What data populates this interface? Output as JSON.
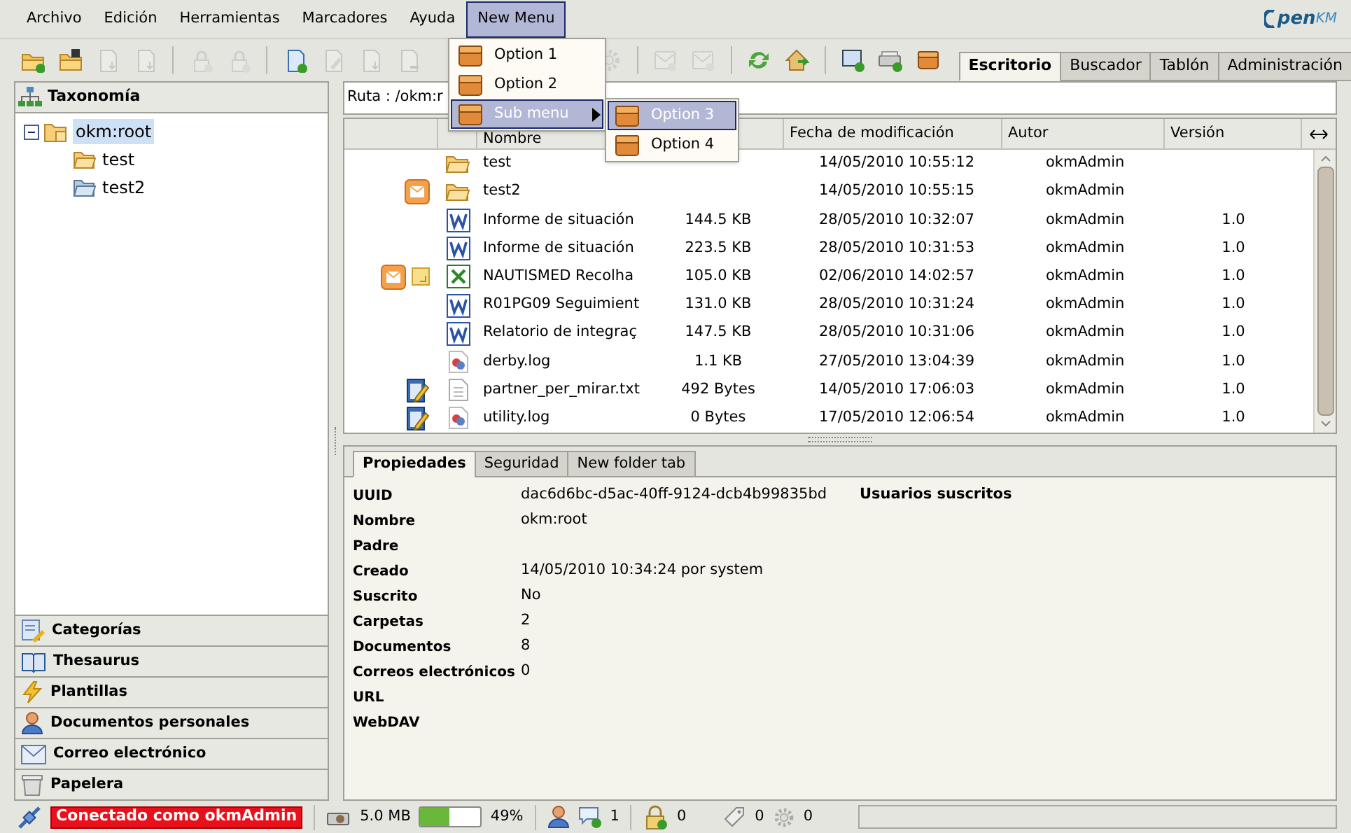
{
  "menubar": [
    {
      "label": "Archivo",
      "selected": false
    },
    {
      "label": "Edición",
      "selected": false
    },
    {
      "label": "Herramientas",
      "selected": false
    },
    {
      "label": "Marcadores",
      "selected": false
    },
    {
      "label": "Ayuda",
      "selected": false
    },
    {
      "label": "New Menu",
      "selected": true
    }
  ],
  "menu": [
    {
      "label": "Option 1",
      "selected": false
    },
    {
      "label": "Option 2",
      "selected": false
    },
    {
      "label": "Sub menu",
      "selected": true,
      "submenu": [
        {
          "label": "Option 3",
          "selected": true
        },
        {
          "label": "Option 4",
          "selected": false
        }
      ]
    }
  ],
  "logo": {
    "text": "pen",
    "suffix": "KM"
  },
  "toolbar_left": [
    {
      "kind": "folder-add",
      "disabled": false
    },
    {
      "kind": "folder-find",
      "disabled": false
    },
    {
      "kind": "download",
      "disabled": true
    },
    {
      "kind": "download-pdf",
      "disabled": true
    },
    {
      "kind": "separator"
    },
    {
      "kind": "lock",
      "disabled": true
    },
    {
      "kind": "unlock",
      "disabled": true
    },
    {
      "kind": "separator"
    },
    {
      "kind": "document-add",
      "disabled": false
    },
    {
      "kind": "edit",
      "disabled": true
    },
    {
      "kind": "checkin",
      "disabled": true
    },
    {
      "kind": "cancel",
      "disabled": true
    }
  ],
  "toolbar_right": [
    {
      "kind": "gear",
      "disabled": true
    },
    {
      "kind": "separator"
    },
    {
      "kind": "mail-add",
      "disabled": true
    },
    {
      "kind": "mail-remove",
      "disabled": true
    },
    {
      "kind": "separator"
    },
    {
      "kind": "refresh",
      "disabled": false
    },
    {
      "kind": "home",
      "disabled": false
    },
    {
      "kind": "separator"
    },
    {
      "kind": "monitor-add",
      "disabled": false
    },
    {
      "kind": "scanner-add",
      "disabled": false
    },
    {
      "kind": "box",
      "disabled": false
    }
  ],
  "tabs": [
    {
      "label": "Escritorio",
      "selected": true
    },
    {
      "label": "Buscador",
      "selected": false
    },
    {
      "label": "Tablón",
      "selected": false
    },
    {
      "label": "Administración",
      "selected": false
    }
  ],
  "taxonomy": {
    "title": "Taxonomía",
    "tree": [
      {
        "label": "okm:root",
        "expanded": true,
        "selected": true,
        "children": [
          {
            "label": "test",
            "kind": "folder-open"
          },
          {
            "label": "test2",
            "kind": "folder-shared"
          }
        ]
      }
    ]
  },
  "panels": [
    {
      "label": "Categorías",
      "kind": "categories"
    },
    {
      "label": "Thesaurus",
      "kind": "thesaurus"
    },
    {
      "label": "Plantillas",
      "kind": "templates"
    },
    {
      "label": "Documentos personales",
      "kind": "personal"
    },
    {
      "label": "Correo electrónico",
      "kind": "mail"
    },
    {
      "label": "Papelera",
      "kind": "trash"
    }
  ],
  "path": "Ruta : /okm:r",
  "table": {
    "columns": [
      {
        "label": "Nombre"
      },
      {
        "label": "Fecha de modificación"
      },
      {
        "label": "Autor"
      },
      {
        "label": "Versión"
      }
    ],
    "rows": [
      {
        "kind": "folder",
        "subscribed": false,
        "note": false,
        "edited": false,
        "name": "test",
        "date": "14/05/2010 10:55:12",
        "author": "okmAdmin"
      },
      {
        "kind": "folder",
        "subscribed": true,
        "note": false,
        "edited": false,
        "name": "test2",
        "date": "14/05/2010 10:55:15",
        "author": "okmAdmin"
      },
      {
        "kind": "word",
        "subscribed": false,
        "note": false,
        "edited": false,
        "name": "Informe de situación",
        "size": "144.5 KB",
        "date": "28/05/2010 10:32:07",
        "author": "okmAdmin",
        "version": "1.0"
      },
      {
        "kind": "word",
        "subscribed": false,
        "note": false,
        "edited": false,
        "name": "Informe de situación",
        "size": "223.5 KB",
        "date": "28/05/2010 10:31:53",
        "author": "okmAdmin",
        "version": "1.0"
      },
      {
        "kind": "excel",
        "subscribed": true,
        "note": true,
        "edited": false,
        "name": "NAUTISMED Recolha",
        "size": "105.0 KB",
        "date": "02/06/2010 14:02:57",
        "author": "okmAdmin",
        "version": "1.0"
      },
      {
        "kind": "word",
        "subscribed": false,
        "note": false,
        "edited": false,
        "name": "R01PG09 Seguimient",
        "size": "131.0 KB",
        "date": "28/05/2010 10:31:24",
        "author": "okmAdmin",
        "version": "1.0"
      },
      {
        "kind": "word",
        "subscribed": false,
        "note": false,
        "edited": false,
        "name": "Relatorio de integraç",
        "size": "147.5 KB",
        "date": "28/05/2010 10:31:06",
        "author": "okmAdmin",
        "version": "1.0"
      },
      {
        "kind": "log",
        "subscribed": false,
        "note": false,
        "edited": false,
        "name": "derby.log",
        "size": "1.1 KB",
        "date": "27/05/2010 13:04:39",
        "author": "okmAdmin",
        "version": "1.0"
      },
      {
        "kind": "text",
        "subscribed": false,
        "note": false,
        "edited": true,
        "name": "partner_per_mirar.txt",
        "size": "492 Bytes",
        "date": "14/05/2010 17:06:03",
        "author": "okmAdmin",
        "version": "1.0"
      },
      {
        "kind": "log",
        "subscribed": false,
        "note": false,
        "edited": true,
        "name": "utility.log",
        "size": "0 Bytes",
        "date": "17/05/2010 12:06:54",
        "author": "okmAdmin",
        "version": "1.0"
      }
    ]
  },
  "properties": {
    "tabs": [
      {
        "label": "Propiedades",
        "selected": true
      },
      {
        "label": "Seguridad",
        "selected": false
      },
      {
        "label": "New folder tab",
        "selected": false
      }
    ],
    "fields": [
      {
        "label": "UUID",
        "value": "dac6d6bc-d5ac-40ff-9124-dcb4b99835bd"
      },
      {
        "label": "Nombre",
        "value": "okm:root"
      },
      {
        "label": "Padre"
      },
      {
        "label": "Creado",
        "value": "14/05/2010 10:34:24 por system"
      },
      {
        "label": "Suscrito",
        "value": "No"
      },
      {
        "label": "Carpetas",
        "value": "2"
      },
      {
        "label": "Documentos",
        "value": "8"
      },
      {
        "label": "Correos electrónicos",
        "value": "0"
      },
      {
        "label": "URL"
      },
      {
        "label": "WebDAV"
      }
    ],
    "subscribers_title": "Usuarios suscritos"
  },
  "status": {
    "connection": "Conectado como okmAdmin",
    "disk": "5.0 MB",
    "level": 0.49,
    "percent": "49%",
    "chats": "1",
    "locked": "0",
    "tags": "0",
    "tasks": "0"
  }
}
